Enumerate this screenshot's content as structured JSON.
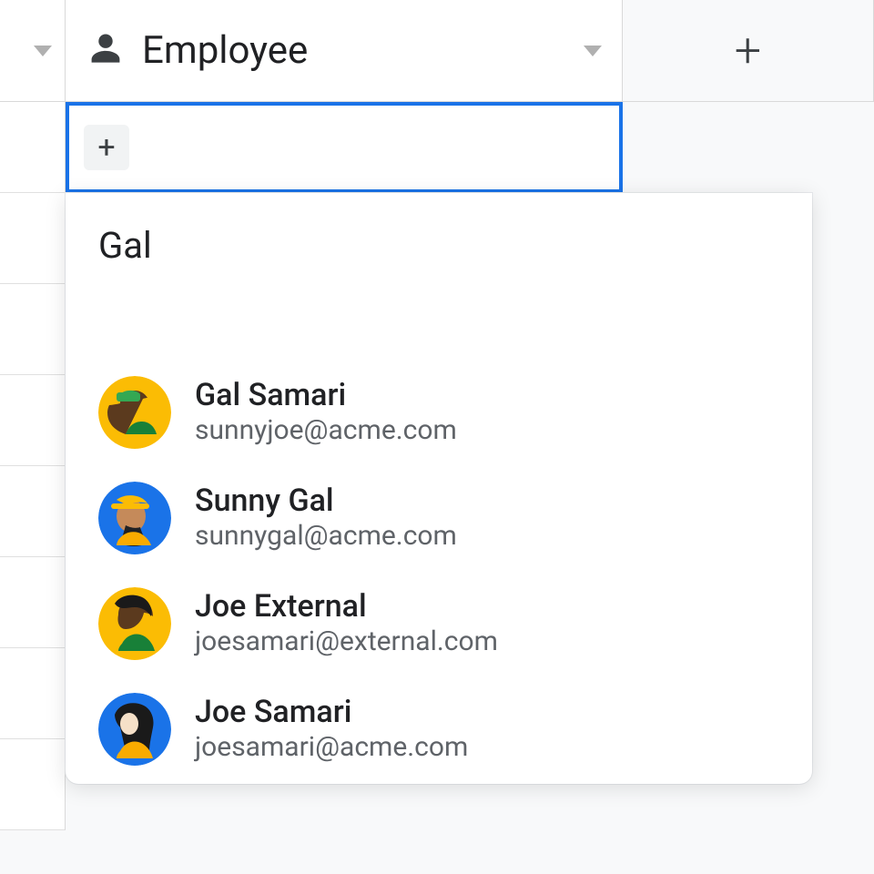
{
  "header": {
    "column_label": "Employee"
  },
  "cell": {
    "search_query": "Gal"
  },
  "results": [
    {
      "name": "Gal Samari",
      "email": "sunnyjoe@acme.com",
      "avatar_bg": "#fbbc04"
    },
    {
      "name": "Sunny Gal",
      "email": "sunnygal@acme.com",
      "avatar_bg": "#1a73e8"
    },
    {
      "name": "Joe External",
      "email": "joesamari@external.com",
      "avatar_bg": "#fbbc04"
    },
    {
      "name": "Joe Samari",
      "email": "joesamari@acme.com",
      "avatar_bg": "#1a73e8"
    }
  ]
}
